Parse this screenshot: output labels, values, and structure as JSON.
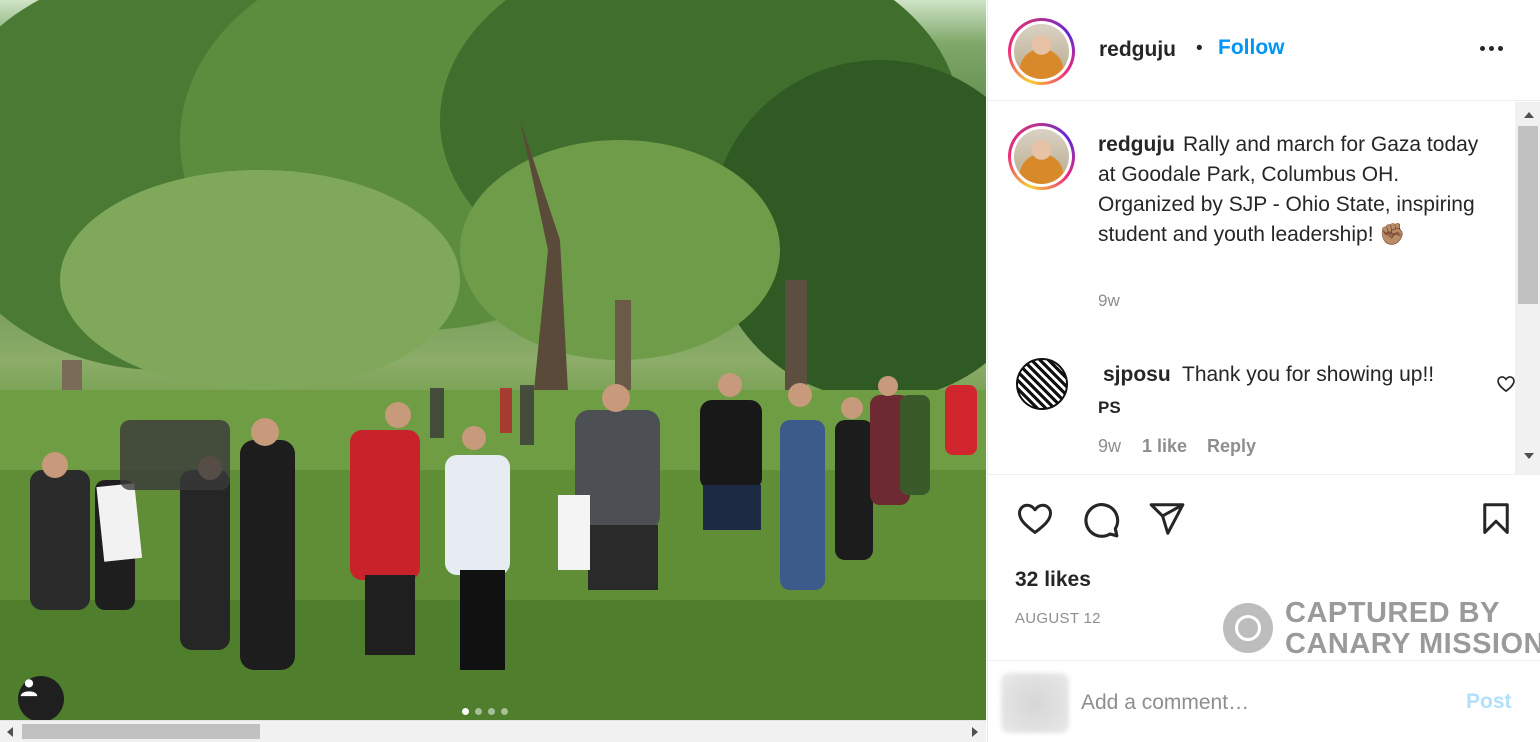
{
  "post": {
    "username": "redguju",
    "follow_label": "Follow",
    "separator": "•",
    "caption": {
      "username": "redguju",
      "text": "Rally and march for Gaza today at Goodale Park, Columbus OH. Organized by SJP - Ohio State, inspiring student and youth leadership! ✊🏽",
      "time": "9w"
    },
    "comments": [
      {
        "username": "sjposu",
        "text": "Thank you for showing up!!",
        "second_line": "PS",
        "time": "9w",
        "likes": "1 like",
        "reply_label": "Reply"
      }
    ],
    "likes": "32 likes",
    "date": "AUGUST 12",
    "comment_placeholder": "Add a comment…",
    "post_label": "Post"
  },
  "carousel": {
    "count": 4,
    "active": 0
  },
  "watermark": {
    "line1": "CAPTURED BY",
    "line2": "CANARY MISSION"
  },
  "colors": {
    "follow": "#0095f6",
    "post_disabled": "#b2dffc",
    "muted": "#8e8e8e"
  },
  "icons": [
    "more-icon",
    "heart-icon",
    "comment-icon",
    "share-icon",
    "bookmark-icon",
    "user-icon",
    "like-comment-icon"
  ]
}
